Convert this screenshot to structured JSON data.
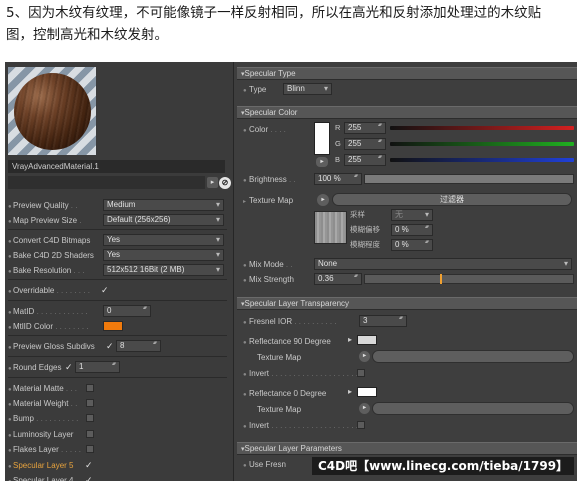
{
  "caption": {
    "line1": "5、因为木纹有纹理，不可能像镜子一样反射相同，所以在高光和反射添加处理过的木纹贴",
    "line2": "图，控制高光和木纹发射。"
  },
  "left_panel": {
    "material_name": "VrayAdvancedMaterial.1",
    "rows": [
      {
        "label": "Preview Quality",
        "dots": " . . ",
        "value": "Medium",
        "kind": "dropdown"
      },
      {
        "label": "Map Preview Size",
        "dots": " . ",
        "value": "Default (256x256)",
        "kind": "dropdown"
      },
      {
        "label": "Convert C4D Bitmaps",
        "dots": "",
        "value": "Yes",
        "kind": "dropdown"
      },
      {
        "label": "Bake C4D 2D Shaders",
        "dots": "",
        "value": "Yes",
        "kind": "dropdown"
      },
      {
        "label": "Bake Resolution",
        "dots": " . . . ",
        "value": "512x512  16Bit  (2 MB)",
        "kind": "dropdown"
      },
      {
        "label": "Overridable",
        "dots": " . . . . . . . . ",
        "value": "✓",
        "kind": "checkmark"
      },
      {
        "label": "MatID",
        "dots": " . . . . . . . . . . . . ",
        "value": "0",
        "kind": "spinner"
      },
      {
        "label": "MtlID Color",
        "dots": " . . . . . . . . ",
        "value": "",
        "kind": "color",
        "color": "#f07a0c"
      },
      {
        "label": "Preview Gloss Subdivs",
        "dots": "",
        "value": "8",
        "kind": "check-spinner"
      },
      {
        "label": "Round Edges",
        "dots": "",
        "value": "1",
        "kind": "check-spinner"
      },
      {
        "label": "Material Matte",
        "dots": " . . . ",
        "value": "",
        "kind": "checkbox"
      },
      {
        "label": "Material Weight",
        "dots": " . . ",
        "value": "",
        "kind": "checkbox"
      },
      {
        "label": "Bump",
        "dots": " . . . . . . . . . . ",
        "value": "",
        "kind": "checkbox"
      },
      {
        "label": "Luminosity Layer",
        "dots": "",
        "value": "",
        "kind": "checkbox"
      },
      {
        "label": "Flakes Layer",
        "dots": " . . . . . ",
        "value": "",
        "kind": "checkbox"
      },
      {
        "label": "Specular Layer 5",
        "dots": "",
        "value": "✓",
        "kind": "checkmark",
        "active": true
      },
      {
        "label": "Specular Layer 4",
        "dots": "",
        "value": "✓",
        "kind": "checkmark"
      }
    ]
  },
  "right_panel": {
    "sections": {
      "specular_type": "Specular Type",
      "specular_color": "Specular Color",
      "transparency": "Specular Layer Transparency",
      "parameters": "Specular Layer Parameters"
    },
    "type_label": "Type",
    "type_value": "Blinn",
    "color_label": "Color",
    "color_dots": " . . . . ",
    "rgb": [
      {
        "channel": "R",
        "value": "255",
        "bar_color": "#d42020"
      },
      {
        "channel": "G",
        "value": "255",
        "bar_color": "#20b020"
      },
      {
        "channel": "B",
        "value": "255",
        "bar_color": "#2040d8"
      }
    ],
    "brightness_label": "Brightness",
    "brightness_dots": " . . ",
    "brightness_value": "100 %",
    "brightness_fraction": 1.0,
    "texture_map_label": "Texture Map",
    "texture_filter_label": "过滤器",
    "sampling_label": "采样",
    "sampling_value": "无",
    "blur_offset_label": "模糊偏移",
    "blur_offset_value": "0 %",
    "blur_degree_label": "模糊程度",
    "blur_degree_value": "0 %",
    "mix_mode_label": "Mix Mode",
    "mix_mode_dots": " . . ",
    "mix_mode_value": "None",
    "mix_strength_label": "Mix Strength",
    "mix_strength_value": "0.36",
    "mix_strength_fraction": 0.36,
    "fresnel_label": "Fresnel IOR",
    "fresnel_dots": " . . . . . . . . . . ",
    "fresnel_value": "3",
    "refl90_label": "Reflectance 90 Degree",
    "refl90_color": "#d8d8d8",
    "texture_map2_label": "Texture Map",
    "invert_label": "Invert",
    "invert_dots": " . . . . . . . . . . . . . . . . . . . . . ",
    "refl0_label": "Reflectance  0 Degree",
    "refl0_color": "#ffffff",
    "texture_map3_label": "Texture Map",
    "invert2_label": "Invert",
    "use_fresnel_label": "Use Fresn",
    "use_fresnel_tail": "x"
  },
  "watermark": "C4D吧【www.linecg.com/tieba/1799】"
}
